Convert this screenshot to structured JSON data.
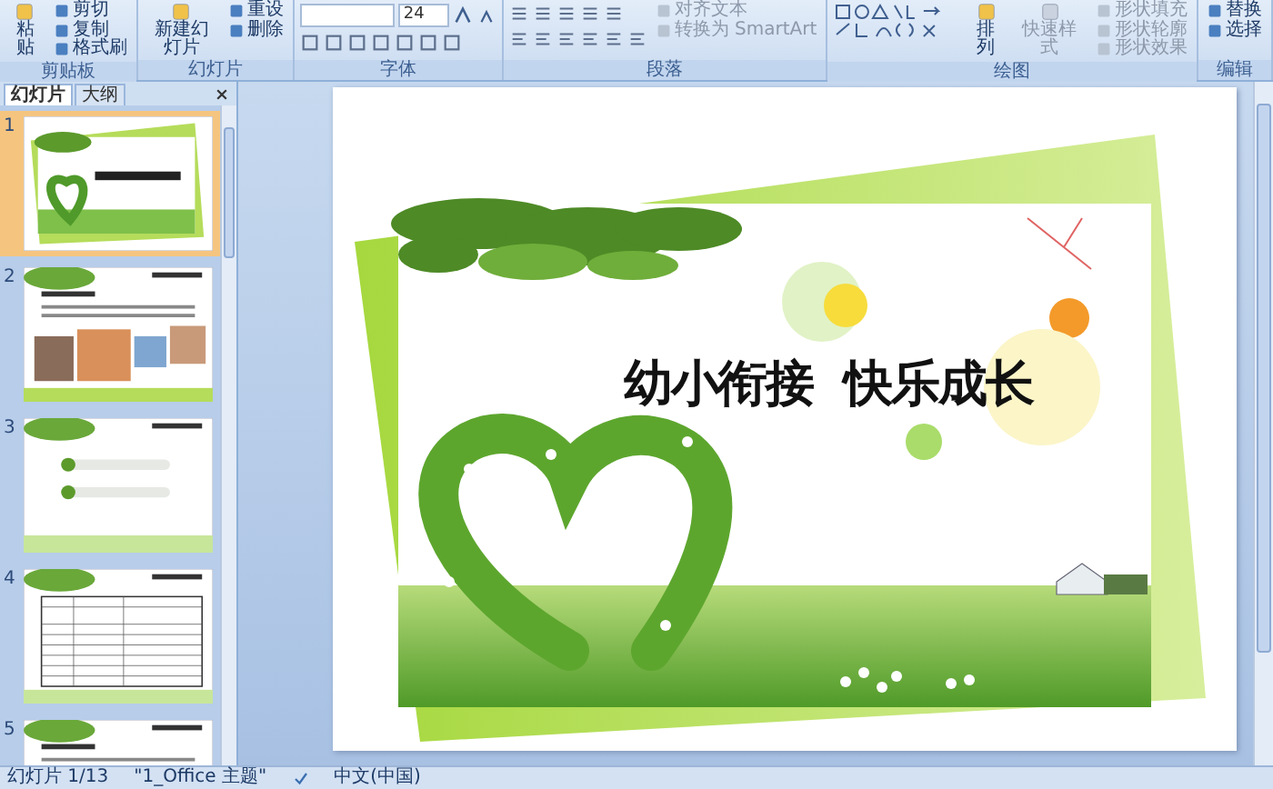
{
  "ribbon": {
    "groups": [
      {
        "label": "剪贴板",
        "items": [
          {
            "kind": "large",
            "label": "粘贴",
            "disabled": false
          },
          {
            "kind": "small",
            "label": "剪切",
            "disabled": false
          },
          {
            "kind": "small",
            "label": "复制",
            "disabled": false
          },
          {
            "kind": "small",
            "label": "格式刷",
            "disabled": false
          }
        ]
      },
      {
        "label": "幻灯片",
        "items": [
          {
            "kind": "large",
            "label": "新建幻灯片",
            "disabled": false
          },
          {
            "kind": "small",
            "label": "重设",
            "disabled": false
          },
          {
            "kind": "small",
            "label": "删除",
            "disabled": false
          }
        ]
      },
      {
        "label": "字体",
        "items": [
          {
            "kind": "field",
            "value": "24"
          }
        ]
      },
      {
        "label": "段落",
        "items": [
          {
            "kind": "toolbar"
          },
          {
            "kind": "small",
            "label": "对齐文本",
            "disabled": true
          },
          {
            "kind": "small",
            "label": "转换为 SmartArt",
            "disabled": true
          }
        ]
      },
      {
        "label": "绘图",
        "items": [
          {
            "kind": "shapes"
          },
          {
            "kind": "large",
            "label": "排列",
            "disabled": false
          },
          {
            "kind": "large",
            "label": "快速样式",
            "disabled": true
          },
          {
            "kind": "small",
            "label": "形状填充",
            "disabled": true
          },
          {
            "kind": "small",
            "label": "形状轮廓",
            "disabled": true
          },
          {
            "kind": "small",
            "label": "形状效果",
            "disabled": true
          }
        ]
      },
      {
        "label": "编辑",
        "items": [
          {
            "kind": "small",
            "label": "替换",
            "disabled": false
          },
          {
            "kind": "small",
            "label": "选择",
            "disabled": false
          }
        ]
      }
    ]
  },
  "panel": {
    "tabs": [
      {
        "label": "幻灯片",
        "selected": true
      },
      {
        "label": "大纲",
        "selected": false
      }
    ],
    "slides": [
      {
        "number": "1",
        "kind": "title",
        "selected": true
      },
      {
        "number": "2",
        "kind": "photos",
        "selected": false
      },
      {
        "number": "3",
        "kind": "list",
        "selected": false
      },
      {
        "number": "4",
        "kind": "table",
        "selected": false
      },
      {
        "number": "5",
        "kind": "photos",
        "selected": false
      }
    ]
  },
  "slide": {
    "title": "幼小衔接  快乐成长"
  },
  "status_bar": [
    "幻灯片 1/13",
    "\"1_Office 主题\"",
    "中文(中国)"
  ]
}
